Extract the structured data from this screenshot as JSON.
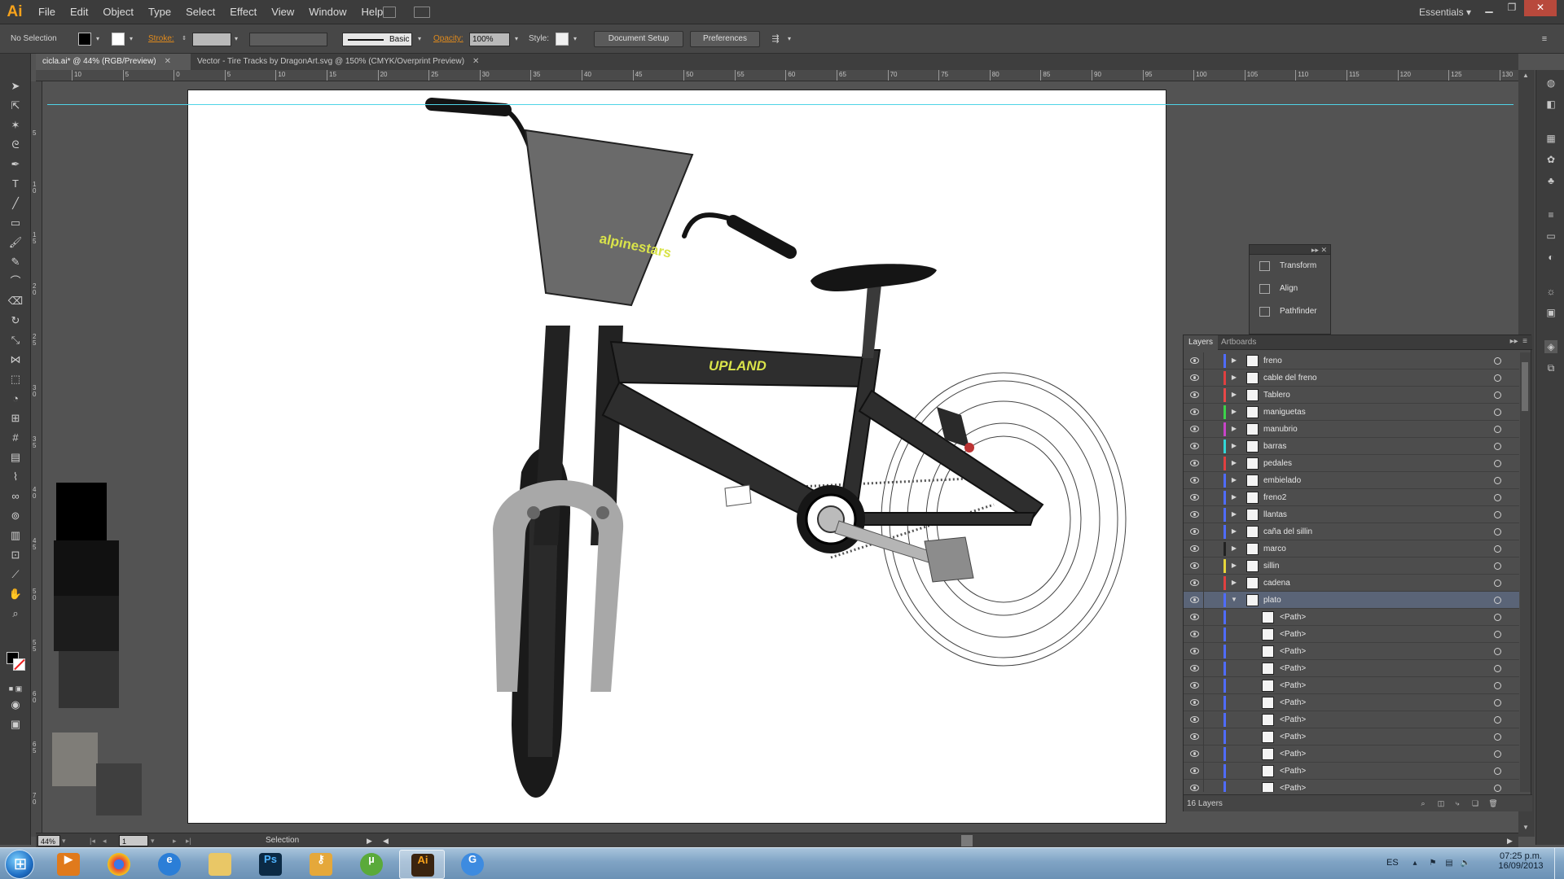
{
  "app": {
    "logo": "Ai",
    "menu": [
      "File",
      "Edit",
      "Object",
      "Type",
      "Select",
      "Effect",
      "View",
      "Window",
      "Help"
    ],
    "workspace": "Essentials"
  },
  "control_bar": {
    "selection": "No Selection",
    "stroke_label": "Stroke:",
    "brush": "Basic",
    "opacity_label": "Opacity:",
    "opacity_value": "100%",
    "style_label": "Style:",
    "document_setup": "Document Setup",
    "preferences": "Preferences"
  },
  "tabs": [
    {
      "label": "cicla.ai* @ 44% (RGB/Preview)",
      "active": true
    },
    {
      "label": "Vector - Tire Tracks by DragonArt.svg @ 150% (CMYK/Overprint Preview)",
      "active": false
    }
  ],
  "ruler_h": [
    "10",
    "5",
    "0",
    "5",
    "10",
    "15",
    "20",
    "25",
    "30",
    "35",
    "40",
    "45",
    "50",
    "55",
    "60",
    "65",
    "70",
    "75",
    "80",
    "85",
    "90",
    "95",
    "100",
    "105",
    "110",
    "115",
    "120",
    "125",
    "130"
  ],
  "ruler_v": [
    "5",
    "1 0",
    "1 5",
    "2 0",
    "2 5",
    "3 0",
    "3 5",
    "4 0",
    "4 5",
    "5 0",
    "5 5",
    "6 0",
    "6 5",
    "7 0"
  ],
  "artwork": {
    "number_plate_text": "alpinestars",
    "frame_text": "UPLAND"
  },
  "float_panel": {
    "items": [
      {
        "label": "Transform",
        "icon": "transform-icon"
      },
      {
        "label": "Align",
        "icon": "align-icon"
      },
      {
        "label": "Pathfinder",
        "icon": "pathfinder-icon"
      }
    ]
  },
  "layers_panel": {
    "tabs": [
      "Layers",
      "Artboards"
    ],
    "layers": [
      {
        "name": "freno",
        "color": "#4f6cff",
        "expanded": false
      },
      {
        "name": "cable del freno",
        "color": "#e04040",
        "expanded": false
      },
      {
        "name": "Tablero",
        "color": "#e84848",
        "expanded": false
      },
      {
        "name": "maniguetas",
        "color": "#3cd24a",
        "expanded": false
      },
      {
        "name": "manubrio",
        "color": "#c844c8",
        "expanded": false
      },
      {
        "name": "barras",
        "color": "#32d6d6",
        "expanded": false
      },
      {
        "name": "pedales",
        "color": "#e04040",
        "expanded": false
      },
      {
        "name": "embielado",
        "color": "#4f6cff",
        "expanded": false
      },
      {
        "name": "freno2",
        "color": "#4f6cff",
        "expanded": false
      },
      {
        "name": "llantas",
        "color": "#4f6cff",
        "expanded": false
      },
      {
        "name": "caña del sillin",
        "color": "#4f6cff",
        "expanded": false
      },
      {
        "name": "marco",
        "color": "#222222",
        "expanded": false
      },
      {
        "name": "sillin",
        "color": "#e6d63a",
        "expanded": false
      },
      {
        "name": "cadena",
        "color": "#e04040",
        "expanded": false
      },
      {
        "name": "plato",
        "color": "#4f6cff",
        "expanded": true
      }
    ],
    "sublayers": [
      "<Path>",
      "<Path>",
      "<Path>",
      "<Path>",
      "<Path>",
      "<Path>",
      "<Path>",
      "<Path>",
      "<Path>",
      "<Path>",
      "<Path>"
    ],
    "count": "16 Layers"
  },
  "status_bar": {
    "zoom": "44%",
    "page": "1",
    "tool": "Selection"
  },
  "taskbar": {
    "apps": [
      "windows-media-player",
      "chrome",
      "internet-explorer",
      "file-explorer",
      "photoshop",
      "keys-app",
      "utorrent",
      "illustrator",
      "g-app"
    ],
    "active_app": "illustrator",
    "ps_label": "Ps",
    "ai_label": "Ai",
    "lang": "ES",
    "time": "07:25 p.m.",
    "date": "16/09/2013"
  }
}
